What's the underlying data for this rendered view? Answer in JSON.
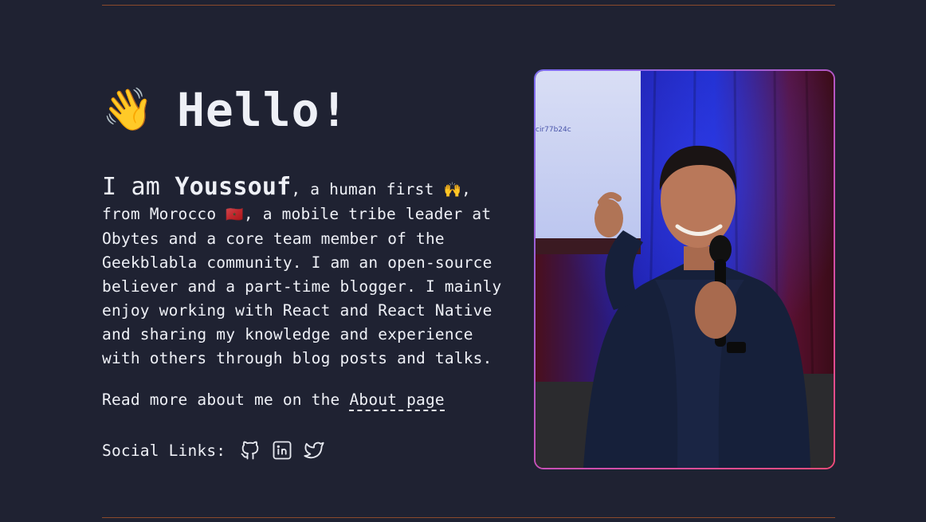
{
  "hero": {
    "wave_emoji": "👋",
    "title": "Hello!"
  },
  "bio": {
    "prefix": "I am ",
    "name": "Youssouf",
    "part1": ", a human first ",
    "emoji_hands": "🙌",
    "part2": ", from Morocco ",
    "emoji_flag": "🇲🇦",
    "part3": ", a mobile tribe leader at Obytes and a core team member of the Geekblabla community. I am an open-source believer and a part-time blogger. I mainly enjoy working with React and React Native and sharing my knowledge and experience with others through blog posts and talks."
  },
  "readmore": {
    "text": "Read more about me on the ",
    "link_label": "About page"
  },
  "social": {
    "label": "Social Links:",
    "icons": [
      "github-icon",
      "linkedin-icon",
      "twitter-icon"
    ]
  },
  "photo": {
    "screen_text": "cir77b24c",
    "frame_gradient": [
      "#7b6cf0",
      "#c94fb4",
      "#ef4b7a"
    ]
  },
  "colors": {
    "background": "#1f2232",
    "text": "#eef0f6",
    "rule": "#8a4a2c"
  }
}
